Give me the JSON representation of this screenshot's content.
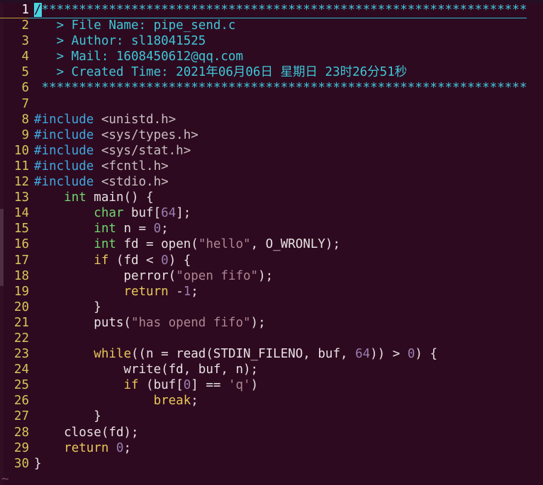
{
  "editor": {
    "name": "vim",
    "colors": {
      "background": "#2e0a20",
      "line_number": "#d8c55a",
      "comment": "#3fc7d8",
      "preprocessor": "#3fa8e0",
      "header_name": "#c9bfc2",
      "type_keyword": "#6fd86f",
      "statement_keyword": "#e7c85a",
      "number": "#9a7fb0",
      "string": "#ae8692",
      "plain_text": "#e8e2e4",
      "cursor": "#49d4e2",
      "cursorline_underline": "#2fb7c6"
    },
    "cursor": {
      "line": 1,
      "column": 1,
      "char": "/"
    },
    "empty_marker": "~",
    "lines": [
      {
        "number": "1",
        "tokens": [
          {
            "t": "/",
            "c": "c-comment cursor"
          },
          {
            "t": "*****************************************************************",
            "c": "c-comment"
          }
        ]
      },
      {
        "number": "2",
        "tokens": [
          {
            "t": "   > File Name: pipe_send.c",
            "c": "c-comment"
          }
        ]
      },
      {
        "number": "3",
        "tokens": [
          {
            "t": "   > Author: sl18041525",
            "c": "c-comment"
          }
        ]
      },
      {
        "number": "4",
        "tokens": [
          {
            "t": "   > Mail: 1608450612@qq.com",
            "c": "c-comment"
          }
        ]
      },
      {
        "number": "5",
        "tokens": [
          {
            "t": "   > Created Time: 2021年06月06日 星期日 23时26分51秒",
            "c": "c-comment"
          }
        ]
      },
      {
        "number": "6",
        "tokens": [
          {
            "t": " *****************************************************************",
            "c": "c-comment"
          }
        ]
      },
      {
        "number": "7",
        "tokens": [
          {
            "t": "",
            "c": "c-plain"
          }
        ]
      },
      {
        "number": "8",
        "tokens": [
          {
            "t": "#include ",
            "c": "c-preproc"
          },
          {
            "t": "<unistd.h>",
            "c": "c-header"
          }
        ]
      },
      {
        "number": "9",
        "tokens": [
          {
            "t": "#include ",
            "c": "c-preproc"
          },
          {
            "t": "<sys/types.h>",
            "c": "c-header"
          }
        ]
      },
      {
        "number": "10",
        "tokens": [
          {
            "t": "#include ",
            "c": "c-preproc"
          },
          {
            "t": "<sys/stat.h>",
            "c": "c-header"
          }
        ]
      },
      {
        "number": "11",
        "tokens": [
          {
            "t": "#include ",
            "c": "c-preproc"
          },
          {
            "t": "<fcntl.h>",
            "c": "c-header"
          }
        ]
      },
      {
        "number": "12",
        "tokens": [
          {
            "t": "#include ",
            "c": "c-preproc"
          },
          {
            "t": "<stdio.h>",
            "c": "c-header"
          }
        ]
      },
      {
        "number": "13",
        "tokens": [
          {
            "t": "    ",
            "c": "c-plain"
          },
          {
            "t": "int",
            "c": "c-type"
          },
          {
            "t": " main() {",
            "c": "c-plain"
          }
        ]
      },
      {
        "number": "14",
        "tokens": [
          {
            "t": "        ",
            "c": "c-plain"
          },
          {
            "t": "char",
            "c": "c-type"
          },
          {
            "t": " buf[",
            "c": "c-plain"
          },
          {
            "t": "64",
            "c": "c-num"
          },
          {
            "t": "];",
            "c": "c-plain"
          }
        ]
      },
      {
        "number": "15",
        "tokens": [
          {
            "t": "        ",
            "c": "c-plain"
          },
          {
            "t": "int",
            "c": "c-type"
          },
          {
            "t": " n = ",
            "c": "c-plain"
          },
          {
            "t": "0",
            "c": "c-num"
          },
          {
            "t": ";",
            "c": "c-plain"
          }
        ]
      },
      {
        "number": "16",
        "tokens": [
          {
            "t": "        ",
            "c": "c-plain"
          },
          {
            "t": "int",
            "c": "c-type"
          },
          {
            "t": " fd = open(",
            "c": "c-plain"
          },
          {
            "t": "\"hello\"",
            "c": "c-str"
          },
          {
            "t": ", O_WRONLY);",
            "c": "c-plain"
          }
        ]
      },
      {
        "number": "17",
        "tokens": [
          {
            "t": "        ",
            "c": "c-plain"
          },
          {
            "t": "if",
            "c": "c-stmt"
          },
          {
            "t": " (fd < ",
            "c": "c-plain"
          },
          {
            "t": "0",
            "c": "c-num"
          },
          {
            "t": ") {",
            "c": "c-plain"
          }
        ]
      },
      {
        "number": "18",
        "tokens": [
          {
            "t": "            perror(",
            "c": "c-plain"
          },
          {
            "t": "\"open fifo\"",
            "c": "c-str"
          },
          {
            "t": ");",
            "c": "c-plain"
          }
        ]
      },
      {
        "number": "19",
        "tokens": [
          {
            "t": "            ",
            "c": "c-plain"
          },
          {
            "t": "return",
            "c": "c-stmt"
          },
          {
            "t": " -",
            "c": "c-plain"
          },
          {
            "t": "1",
            "c": "c-num"
          },
          {
            "t": ";",
            "c": "c-plain"
          }
        ]
      },
      {
        "number": "20",
        "tokens": [
          {
            "t": "        }",
            "c": "c-plain"
          }
        ]
      },
      {
        "number": "21",
        "tokens": [
          {
            "t": "        puts(",
            "c": "c-plain"
          },
          {
            "t": "\"has opend fifo\"",
            "c": "c-str"
          },
          {
            "t": ");",
            "c": "c-plain"
          }
        ]
      },
      {
        "number": "22",
        "tokens": [
          {
            "t": "",
            "c": "c-plain"
          }
        ]
      },
      {
        "number": "23",
        "tokens": [
          {
            "t": "        ",
            "c": "c-plain"
          },
          {
            "t": "while",
            "c": "c-stmt"
          },
          {
            "t": "((n = read(STDIN_FILENO, buf, ",
            "c": "c-plain"
          },
          {
            "t": "64",
            "c": "c-num"
          },
          {
            "t": ")) > ",
            "c": "c-plain"
          },
          {
            "t": "0",
            "c": "c-num"
          },
          {
            "t": ") {",
            "c": "c-plain"
          }
        ]
      },
      {
        "number": "24",
        "tokens": [
          {
            "t": "            write(fd, buf, n);",
            "c": "c-plain"
          }
        ]
      },
      {
        "number": "25",
        "tokens": [
          {
            "t": "            ",
            "c": "c-plain"
          },
          {
            "t": "if",
            "c": "c-stmt"
          },
          {
            "t": " (buf[",
            "c": "c-plain"
          },
          {
            "t": "0",
            "c": "c-num"
          },
          {
            "t": "] == ",
            "c": "c-plain"
          },
          {
            "t": "'q'",
            "c": "c-str"
          },
          {
            "t": ")",
            "c": "c-plain"
          }
        ]
      },
      {
        "number": "26",
        "tokens": [
          {
            "t": "                ",
            "c": "c-plain"
          },
          {
            "t": "break",
            "c": "c-stmt"
          },
          {
            "t": ";",
            "c": "c-plain"
          }
        ]
      },
      {
        "number": "27",
        "tokens": [
          {
            "t": "        }",
            "c": "c-plain"
          }
        ]
      },
      {
        "number": "28",
        "tokens": [
          {
            "t": "    close(fd);",
            "c": "c-plain"
          }
        ]
      },
      {
        "number": "29",
        "tokens": [
          {
            "t": "    ",
            "c": "c-plain"
          },
          {
            "t": "return",
            "c": "c-stmt"
          },
          {
            "t": " ",
            "c": "c-plain"
          },
          {
            "t": "0",
            "c": "c-num"
          },
          {
            "t": ";",
            "c": "c-plain"
          }
        ]
      },
      {
        "number": "30",
        "tokens": [
          {
            "t": "}",
            "c": "c-plain"
          }
        ]
      }
    ]
  },
  "scrollbar": {
    "thumb_top_pct": 43,
    "thumb_height_pct": 16
  }
}
